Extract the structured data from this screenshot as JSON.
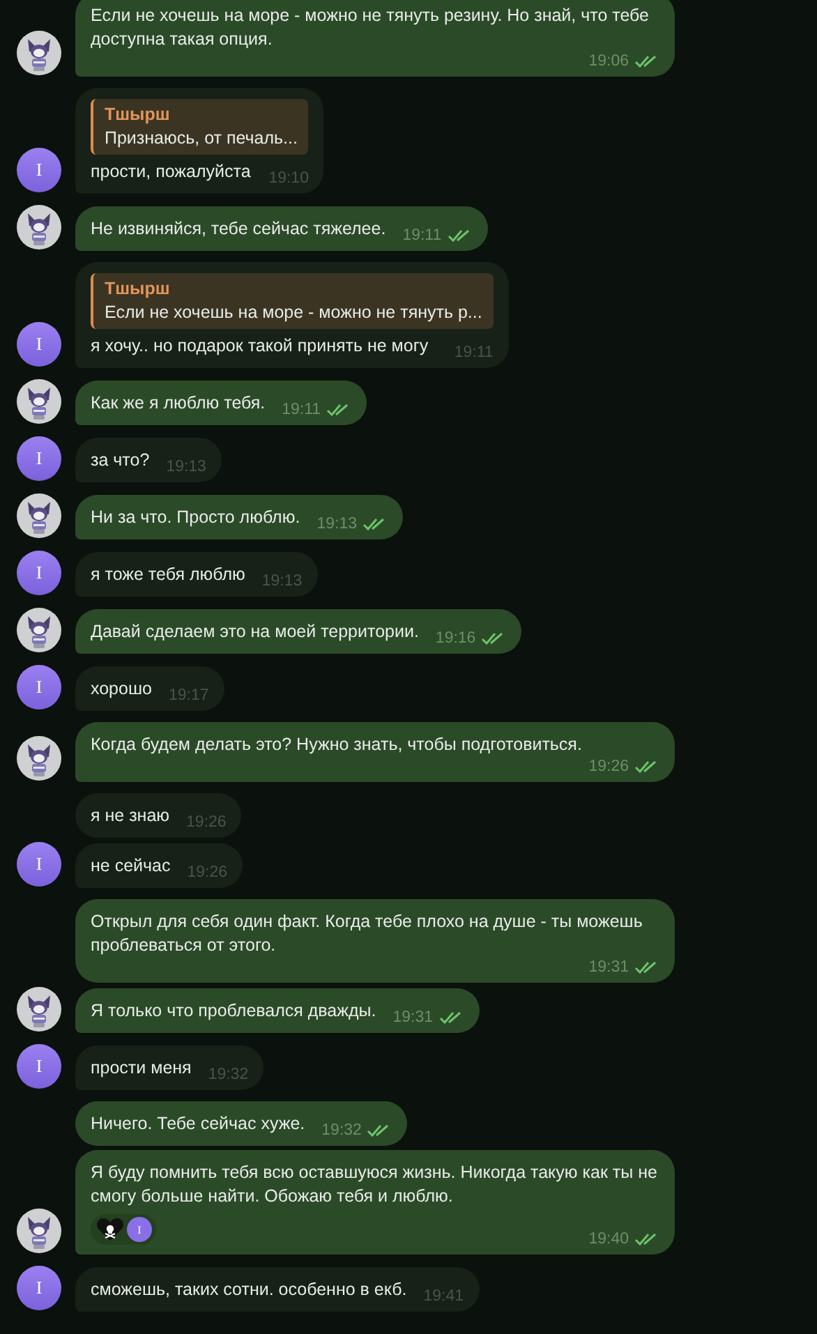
{
  "messages": [
    {
      "kind": "outgoing",
      "avatar": true,
      "text": "Если не хочешь на море - можно не тянуть резину. Но знай, что тебе доступна такая опция.",
      "time": "19:06",
      "read": true
    },
    {
      "kind": "incoming",
      "avatar": true,
      "avatar_letter": "I",
      "reply": {
        "name": "Тшырш",
        "text": "Признаюсь, от печаль..."
      },
      "text": "прости, пожалуйста",
      "time": "19:10"
    },
    {
      "kind": "outgoing",
      "avatar": true,
      "text": "Не извиняйся, тебе сейчас тяжелее.",
      "time": "19:11",
      "read": true
    },
    {
      "kind": "incoming",
      "avatar": true,
      "avatar_letter": "I",
      "reply": {
        "name": "Тшырш",
        "text": "Если не хочешь на море - можно не тянуть р..."
      },
      "text": "я хочу.. но подарок такой принять не могу",
      "time": "19:11"
    },
    {
      "kind": "outgoing",
      "avatar": true,
      "text": "Как же я люблю тебя.",
      "time": "19:11",
      "read": true
    },
    {
      "kind": "incoming",
      "avatar": true,
      "avatar_letter": "I",
      "text": "за что?",
      "time": "19:13"
    },
    {
      "kind": "outgoing",
      "avatar": true,
      "text": "Ни за что. Просто люблю.",
      "time": "19:13",
      "read": true
    },
    {
      "kind": "incoming",
      "avatar": true,
      "avatar_letter": "I",
      "text": "я тоже тебя люблю",
      "time": "19:13"
    },
    {
      "kind": "outgoing",
      "avatar": true,
      "text": "Давай сделаем это на моей территории.",
      "time": "19:16",
      "read": true
    },
    {
      "kind": "incoming",
      "avatar": true,
      "avatar_letter": "I",
      "text": "хорошо",
      "time": "19:17"
    },
    {
      "kind": "outgoing",
      "avatar": true,
      "text": "Когда будем делать это? Нужно знать, чтобы подготовиться.",
      "time": "19:26",
      "read": true
    },
    {
      "kind": "incoming",
      "avatar": false,
      "text": "я не знаю",
      "time": "19:26"
    },
    {
      "kind": "incoming",
      "avatar": true,
      "avatar_letter": "I",
      "text": "не сейчас",
      "time": "19:26"
    },
    {
      "kind": "outgoing",
      "avatar": false,
      "text": "Открыл для себя один факт. Когда тебе плохо на душе - ты можешь проблеваться от этого.",
      "time": "19:31",
      "read": true
    },
    {
      "kind": "outgoing",
      "avatar": true,
      "text": "Я только что проблевался дважды.",
      "time": "19:31",
      "read": true
    },
    {
      "kind": "incoming",
      "avatar": true,
      "avatar_letter": "I",
      "text": "прости меня",
      "time": "19:32"
    },
    {
      "kind": "outgoing",
      "avatar": false,
      "text": "Ничего. Тебе сейчас хуже.",
      "time": "19:32",
      "read": true
    },
    {
      "kind": "outgoing",
      "avatar": true,
      "text": "Я буду помнить тебя всю оставшуюся жизнь. Никогда такую как ты не смогу больше найти. Обожаю тебя и люблю.",
      "time": "19:40",
      "read": true,
      "reaction": {
        "avatar_letter": "I"
      }
    },
    {
      "kind": "incoming",
      "avatar": true,
      "avatar_letter": "I",
      "text": "сможешь, таких сотни. особенно в екб.",
      "time": "19:41"
    }
  ]
}
